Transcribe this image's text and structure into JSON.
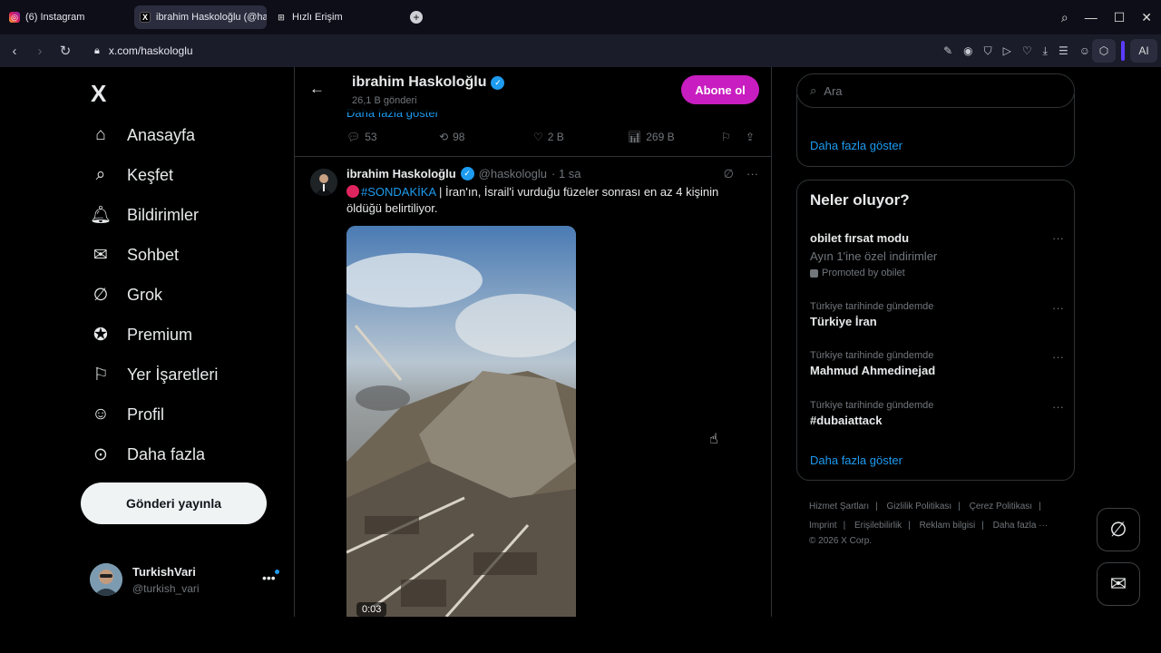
{
  "browser": {
    "tabs": [
      {
        "label": "(6) Instagram",
        "icon": "instagram-icon"
      },
      {
        "label": "ibrahim Haskoloğlu (@has",
        "icon": "x-icon"
      },
      {
        "label": "Hızlı Erişim",
        "icon": "grid-icon"
      }
    ],
    "url": "x.com/haskologlu",
    "ai_label": "AI"
  },
  "nav": {
    "logo": "X",
    "items": [
      {
        "label": "Anasayfa",
        "icon": "home-icon"
      },
      {
        "label": "Keşfet",
        "icon": "search-icon"
      },
      {
        "label": "Bildirimler",
        "icon": "bell-icon"
      },
      {
        "label": "Sohbet",
        "icon": "mail-icon"
      },
      {
        "label": "Grok",
        "icon": "grok-icon"
      },
      {
        "label": "Premium",
        "icon": "premium-icon"
      },
      {
        "label": "Yer İşaretleri",
        "icon": "bookmark-icon"
      },
      {
        "label": "Profil",
        "icon": "profile-icon"
      },
      {
        "label": "Daha fazla",
        "icon": "more-circle-icon"
      }
    ],
    "post_button": "Gönderi yayınla",
    "account": {
      "name": "TurkishVari",
      "handle": "@turkish_vari"
    }
  },
  "profile": {
    "name": "ibrahim Haskoloğlu",
    "post_count": "26,1 B gönderi",
    "subscribe": "Abone ol"
  },
  "prev_tweet": {
    "show_more": "Daha fazla göster",
    "replies": "53",
    "reposts": "98",
    "likes": "2 B",
    "views": "269 B"
  },
  "tweet": {
    "name": "ibrahim Haskoloğlu",
    "handle": "@haskologlu",
    "time": "· 1 sa",
    "hashtag": "#SONDAKİKA",
    "text": " | İran'ın, İsrail'i vurduğu füzeler sonrası en az 4 kişinin öldüğü belirtiliyor.",
    "video_time": "0:03"
  },
  "right": {
    "search_placeholder": "Ara",
    "card1_more": "Daha fazla göster",
    "trends_title": "Neler oluyor?",
    "trends": [
      {
        "title": "obilet fırsat modu",
        "sub": "Ayın 1'ine özel indirimler",
        "promo": "Promoted by obilet"
      },
      {
        "context": "Türkiye tarihinde gündemde",
        "title": "Türkiye İran"
      },
      {
        "context": "Türkiye tarihinde gündemde",
        "title": "Mahmud Ahmedinejad"
      },
      {
        "context": "Türkiye tarihinde gündemde",
        "title": "#dubaiattack"
      }
    ],
    "trends_more": "Daha fazla göster",
    "footer": [
      "Hizmet Şartları",
      "Gizlilik Politikası",
      "Çerez Politikası",
      "Imprint",
      "Erişilebilirlik",
      "Reklam bilgisi",
      "Daha fazla ···",
      "© 2026 X Corp."
    ]
  },
  "colors": {
    "accent": "#1d9bf0",
    "subscribe": "#c81dc0",
    "border": "#2f3336"
  }
}
